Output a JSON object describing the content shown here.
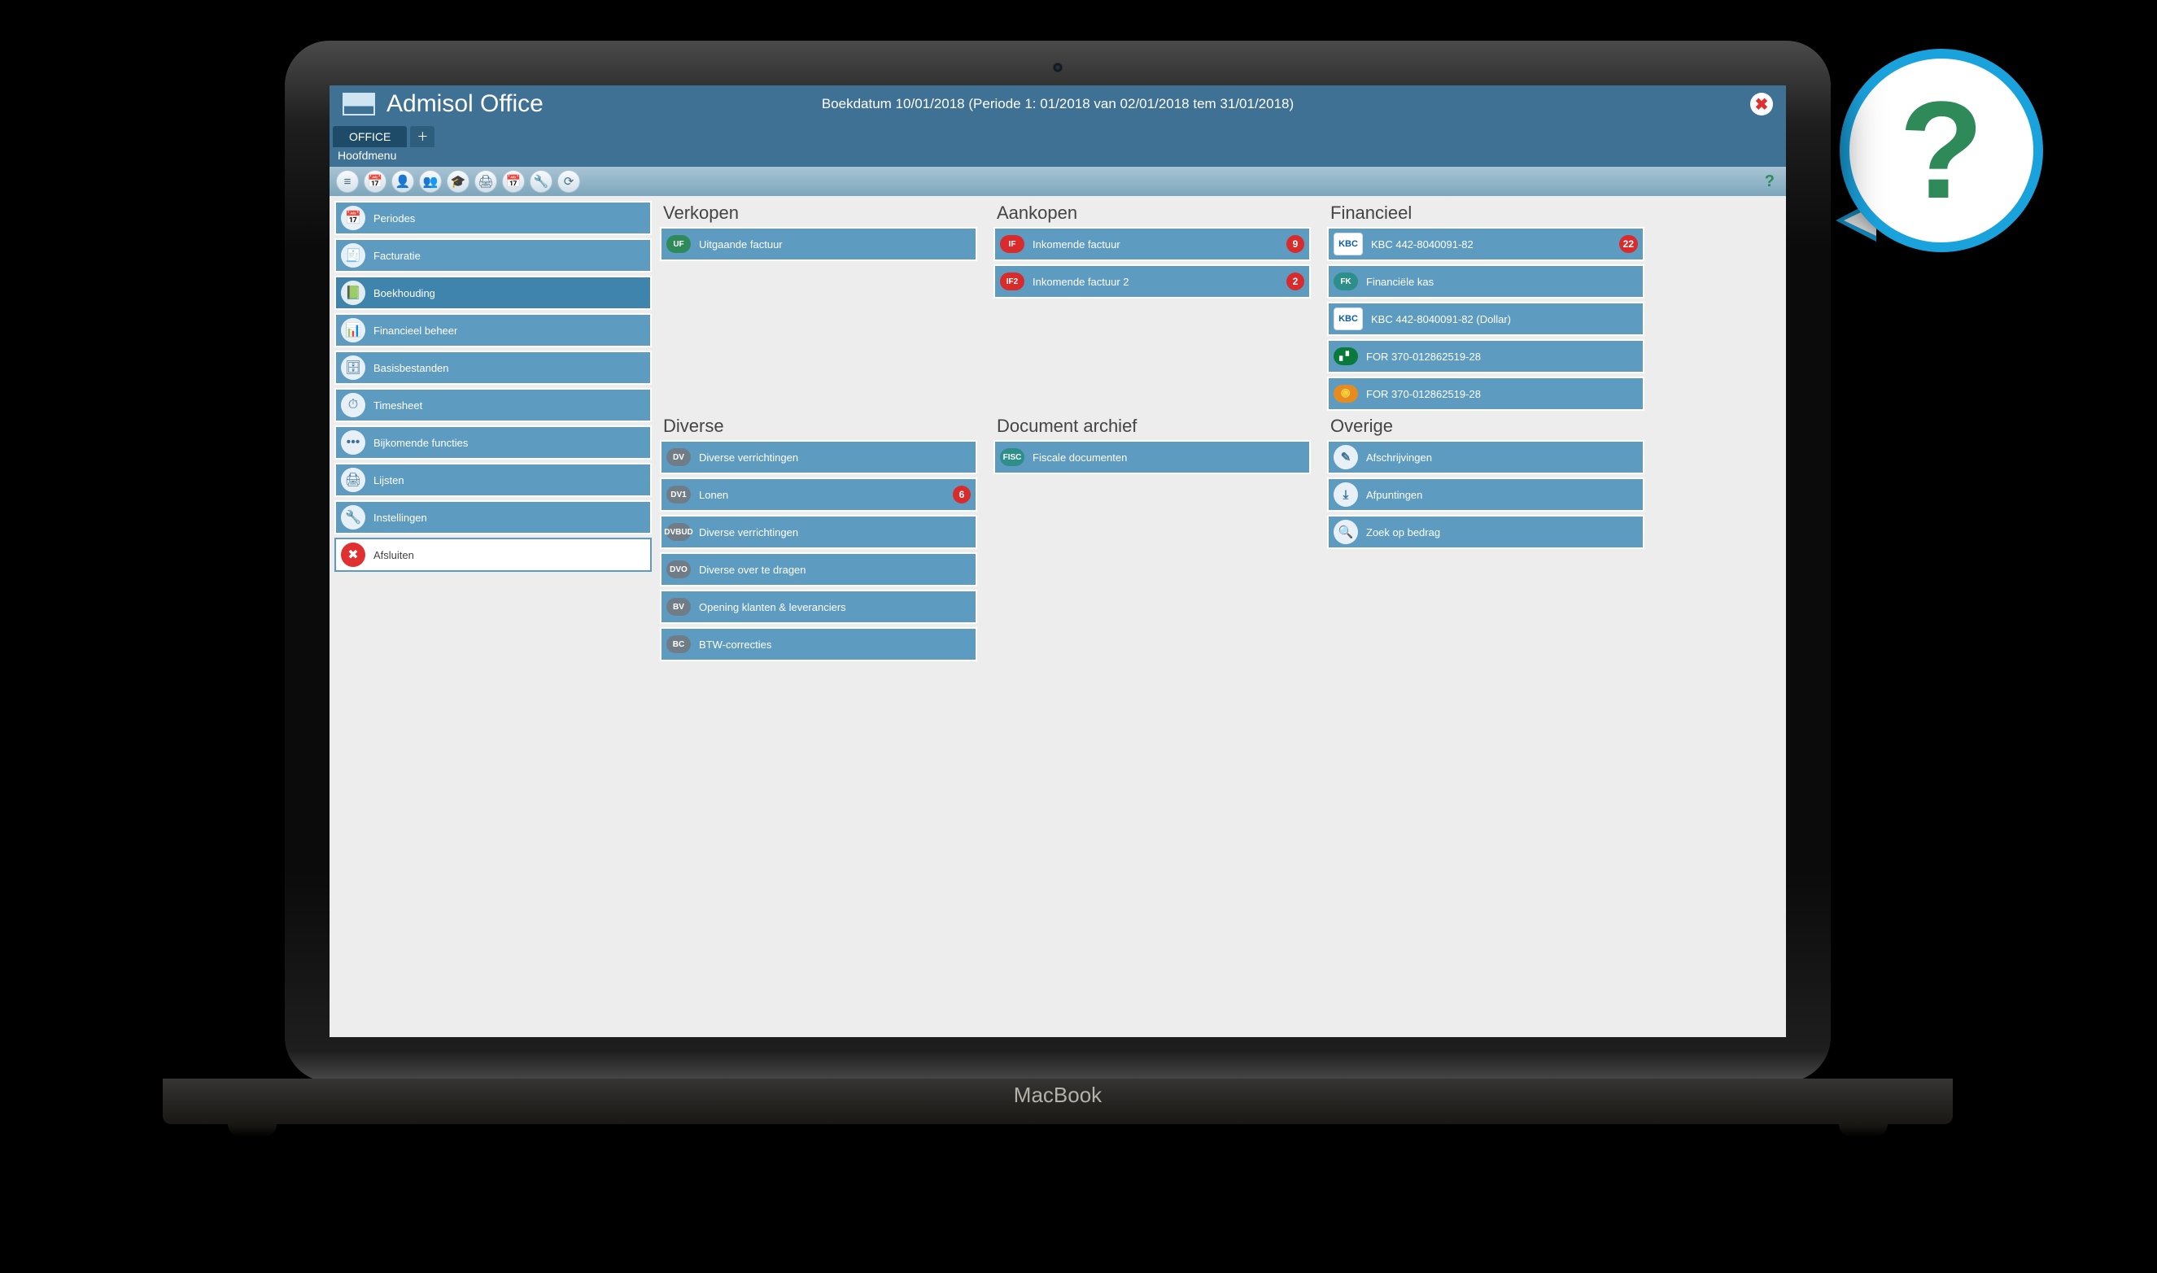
{
  "app": {
    "title": "Admisol Office",
    "status": "Boekdatum 10/01/2018 (Periode 1: 01/2018 van 02/01/2018 tem 31/01/2018)",
    "tab_label": "OFFICE",
    "crumb": "Hoofdmenu",
    "macbook_label": "MacBook"
  },
  "toolbar_icons": [
    "≡",
    "📅",
    "👤",
    "👥",
    "🎓",
    "🖨",
    "📅",
    "🔧",
    "⟳"
  ],
  "sidebar": [
    {
      "label": "Periodes",
      "icon": "📅"
    },
    {
      "label": "Facturatie",
      "icon": "🧾"
    },
    {
      "label": "Boekhouding",
      "icon": "📗",
      "selected": true
    },
    {
      "label": "Financieel beheer",
      "icon": "📊"
    },
    {
      "label": "Basisbestanden",
      "icon": "🗄"
    },
    {
      "label": "Timesheet",
      "icon": "⏱"
    },
    {
      "label": "Bijkomende functies",
      "icon": "•••"
    },
    {
      "label": "Lijsten",
      "icon": "🖨"
    },
    {
      "label": "Instellingen",
      "icon": "🔧"
    },
    {
      "label": "Afsluiten",
      "icon": "✖",
      "white": true
    }
  ],
  "sections": {
    "verkopen": {
      "title": "Verkopen",
      "items": [
        {
          "chip": "UF",
          "chip_style": "",
          "label": "Uitgaande factuur"
        }
      ]
    },
    "aankopen": {
      "title": "Aankopen",
      "items": [
        {
          "chip": "IF",
          "chip_style": "red",
          "label": "Inkomende factuur",
          "badge": "9"
        },
        {
          "chip": "IF2",
          "chip_style": "red",
          "label": "Inkomende factuur 2",
          "badge": "2"
        }
      ]
    },
    "financieel": {
      "title": "Financieel",
      "items": [
        {
          "chip": "KBC",
          "chip_style": "img",
          "label": "KBC 442-8040091-82",
          "badge": "22"
        },
        {
          "chip": "FK",
          "chip_style": "teal",
          "label": "Financiële kas"
        },
        {
          "chip": "KBC",
          "chip_style": "img",
          "label": "KBC 442-8040091-82 (Dollar)"
        },
        {
          "chip": "▖▘",
          "chip_style": "green2",
          "label": "FOR 370-012862519-28"
        },
        {
          "chip": "🪙",
          "chip_style": "orange",
          "label": "FOR 370-012862519-28"
        }
      ]
    },
    "diverse": {
      "title": "Diverse",
      "items": [
        {
          "chip": "DV",
          "chip_style": "gray",
          "label": "Diverse verrichtingen"
        },
        {
          "chip": "DV1",
          "chip_style": "gray",
          "label": "Lonen",
          "badge": "6"
        },
        {
          "chip": "DVBUD",
          "chip_style": "gray",
          "label": "Diverse verrichtingen"
        },
        {
          "chip": "DVO",
          "chip_style": "gray",
          "label": "Diverse over te dragen"
        },
        {
          "chip": "BV",
          "chip_style": "gray",
          "label": "Opening klanten & leveranciers"
        },
        {
          "chip": "BC",
          "chip_style": "gray",
          "label": "BTW-correcties"
        }
      ]
    },
    "docarchief": {
      "title": "Document archief",
      "items": [
        {
          "chip": "FISC",
          "chip_style": "teal",
          "label": "Fiscale documenten"
        }
      ]
    },
    "overige": {
      "title": "Overige",
      "items": [
        {
          "chip": "✎",
          "chip_style": "circle",
          "label": "Afschrijvingen"
        },
        {
          "chip": "⤓",
          "chip_style": "circle",
          "label": "Afpuntingen"
        },
        {
          "chip": "🔍",
          "chip_style": "circle",
          "label": "Zoek op bedrag"
        }
      ]
    }
  }
}
